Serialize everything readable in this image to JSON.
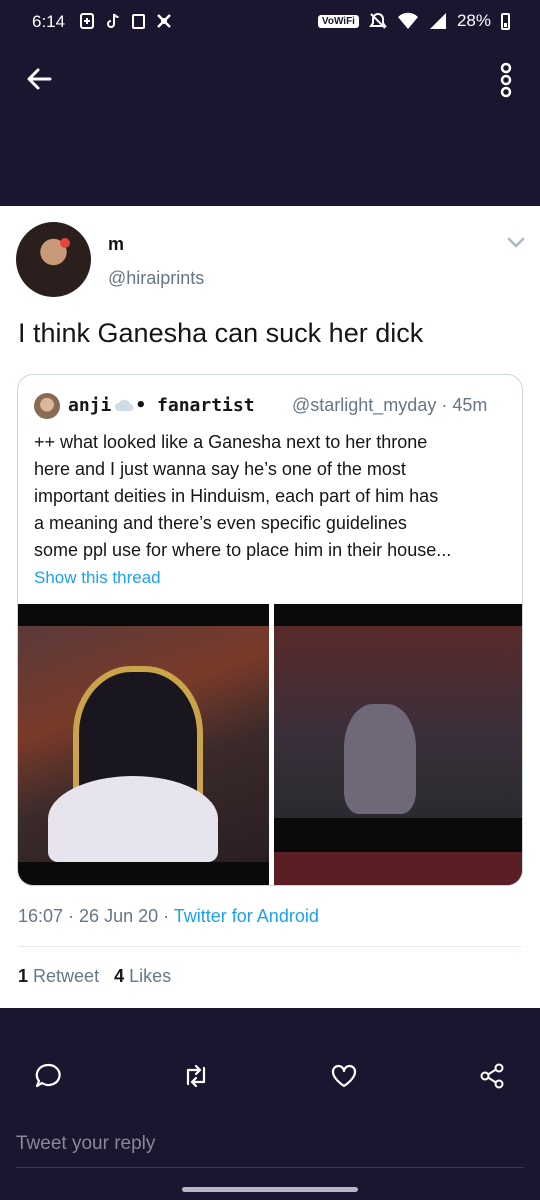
{
  "status_bar": {
    "time": "6:14",
    "wifi_label": "VoWiFi",
    "battery": "28%",
    "icons_left": [
      "plus-box-icon",
      "tiktok-icon",
      "square-icon",
      "app-icon"
    ],
    "icons_right": [
      "mute-icon",
      "wifi-icon",
      "signal-icon",
      "battery-icon"
    ]
  },
  "app_bar": {
    "back_icon": "arrow-left-icon",
    "more_icon": "more-vertical-icon"
  },
  "tweet": {
    "name": "m",
    "handle": "@hiraiprints",
    "text": "I think Ganesha can suck her dick",
    "quote": {
      "name": "anji",
      "name_suffix": "• fanartist",
      "handle": "@starlight_myday · 45m",
      "lines": [
        "++ what looked like a Ganesha next to her throne",
        "here and I just wanna say he’s one of the most",
        "important deities in Hinduism, each part of him has",
        "a meaning and there’s even specific guidelines",
        "some ppl use for where to place him in their house..."
      ],
      "show_thread": "Show this thread"
    },
    "time": "16:07 · 26 Jun 20 · ",
    "source": "Twitter for Android",
    "retweets_count": "1",
    "retweets_label": "Retweet",
    "likes_count": "4",
    "likes_label": "Likes"
  },
  "actions": [
    "reply-icon",
    "retweet-icon",
    "like-icon",
    "share-icon"
  ],
  "reply_placeholder": "Tweet your reply",
  "colors": {
    "background": "#1b1530",
    "accent": "#1da1f2",
    "card": "#ffffff"
  }
}
